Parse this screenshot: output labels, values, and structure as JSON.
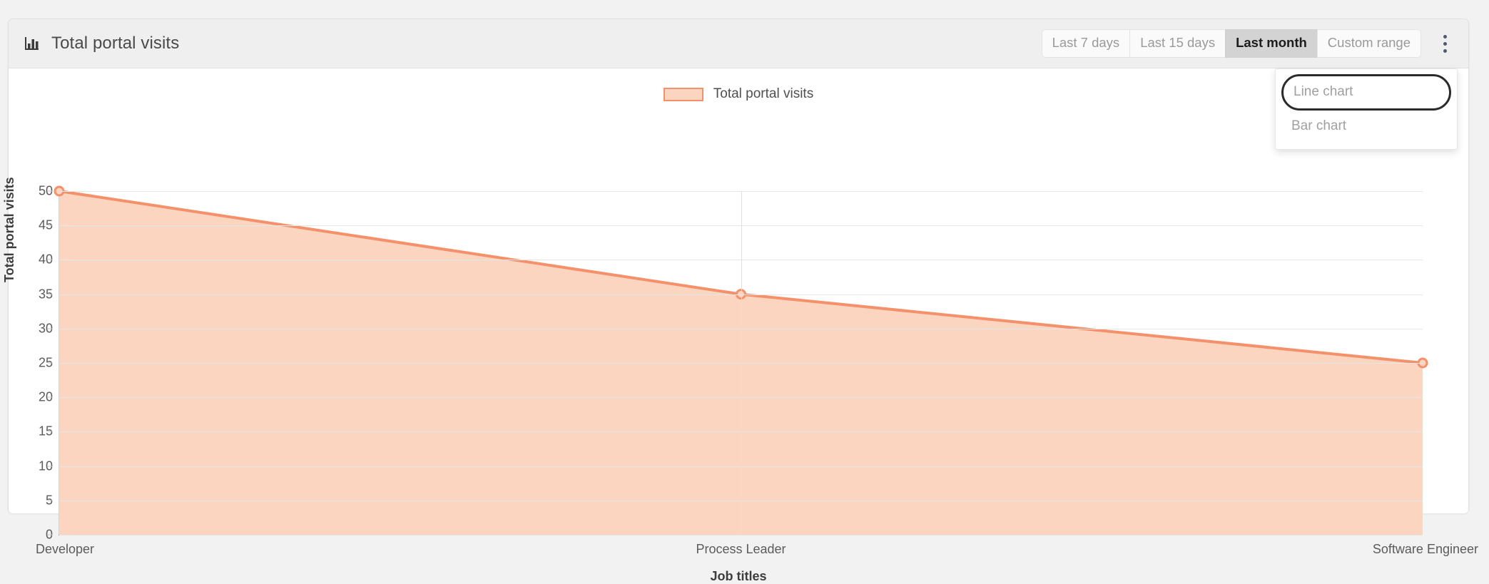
{
  "card": {
    "title": "Total portal visits",
    "icon": "bar-chart-icon"
  },
  "toolbar": {
    "range_buttons": [
      {
        "label": "Last 7 days",
        "active": false
      },
      {
        "label": "Last 15 days",
        "active": false
      },
      {
        "label": "Last month",
        "active": true
      },
      {
        "label": "Custom range",
        "active": false
      }
    ],
    "menu_icon": "kebab-menu-icon"
  },
  "dropdown": {
    "open": true,
    "items": [
      {
        "label": "Line chart",
        "focused": true
      },
      {
        "label": "Bar chart",
        "focused": false
      }
    ]
  },
  "colors": {
    "series_stroke": "#f4916a",
    "series_fill": "#fcd5c0",
    "header_bg": "#efefef",
    "active_button_bg": "#d3d3d3",
    "grid": "#e6e6e6",
    "text": "#4f4f4f"
  },
  "chart_data": {
    "type": "area",
    "title": "",
    "categories": [
      "Developer",
      "Process Leader",
      "Software Engineer"
    ],
    "series": [
      {
        "name": "Total portal visits",
        "values": [
          50,
          35,
          25
        ]
      }
    ],
    "xlabel": "Job titles",
    "ylabel": "Total portal visits",
    "ylim": [
      0,
      50
    ],
    "yticks": [
      0,
      5,
      10,
      15,
      20,
      25,
      30,
      35,
      40,
      45,
      50
    ],
    "grid": true,
    "legend": {
      "position": "top-center",
      "entries": [
        "Total portal visits"
      ]
    }
  }
}
